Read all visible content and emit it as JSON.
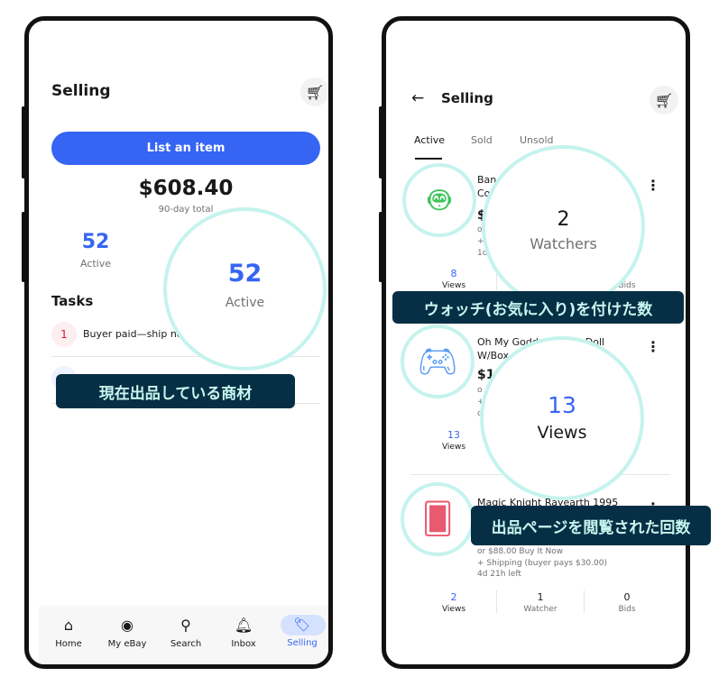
{
  "left": {
    "title": "Selling",
    "list_button": "List an item",
    "total": "$608.40",
    "total_label": "90-day total",
    "active_count": "52",
    "active_label": "Active",
    "tasks_title": "Tasks",
    "tasks": [
      {
        "count": "1",
        "text": "Buyer paid—ship no"
      }
    ],
    "callout": {
      "value": "52",
      "label": "Active"
    },
    "annotation": "現在出品している商材",
    "nav": [
      "Home",
      "My eBay",
      "Search",
      "Inbox",
      "Selling"
    ],
    "nav_active": "Selling"
  },
  "right": {
    "title": "Selling",
    "tabs": [
      "Active",
      "Sold",
      "Unsold"
    ],
    "active_tab": "Active",
    "items": [
      {
        "title_lines": [
          "Ban",
          "Co"
        ],
        "price": "$",
        "detail_lines": [
          "o",
          "+",
          "1o"
        ],
        "views": "8",
        "views_label": "Views",
        "bids_label": "Bids",
        "image": "green-robot"
      },
      {
        "title_lines": [
          "Oh My Godd          dy Doll",
          "W/Box          ng..."
        ],
        "price": "$1",
        "detail_lines": [
          "o",
          "+",
          "c"
        ],
        "views": "13",
        "views_label": "Views",
        "image": "game-controller"
      },
      {
        "title_lines": [
          "Magic Knight Rayearth 1995"
        ],
        "detail_lines": [
          "or $88.00 Buy It Now",
          "+ Shipping (buyer pays $30.00)",
          "4d 21h left"
        ],
        "views": "2",
        "views_label": "Views",
        "watchers": "1",
        "watchers_label": "Watcher",
        "bids": "0",
        "bids_label": "Bids",
        "image": "trading-cards"
      }
    ],
    "callout_watchers": {
      "value": "2",
      "label": "Watchers"
    },
    "callout_views": {
      "value": "13",
      "label": "Views"
    },
    "annotation_watchers": "ウォッチ(お気に入り)を付けた数",
    "annotation_views": "出品ページを閲覧された回数"
  },
  "colors": {
    "accent": "#3665f3",
    "ring": "#c5f3ee",
    "annotation_bg": "#062f45"
  }
}
